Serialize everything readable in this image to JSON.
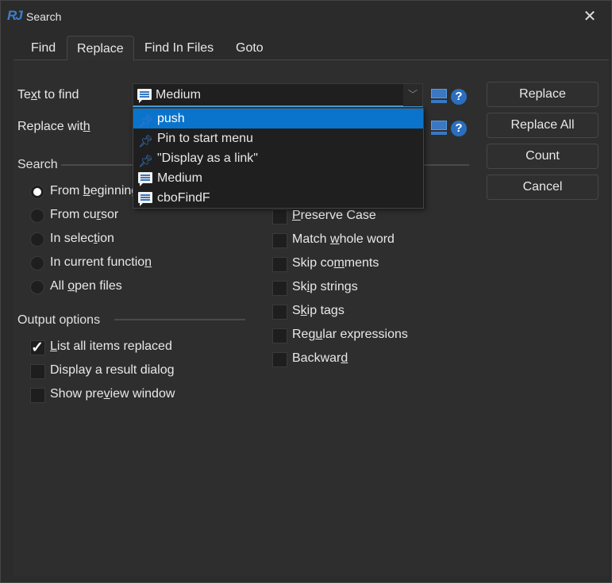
{
  "window": {
    "title": "Search",
    "logo": "RJ",
    "close_icon": "close-icon"
  },
  "tabs": [
    {
      "label": "Find"
    },
    {
      "label": "Replace",
      "active": true
    },
    {
      "label": "Find In Files"
    },
    {
      "label": "Goto"
    }
  ],
  "fields": {
    "find": {
      "pre": "Te",
      "key": "x",
      "post": "t to find",
      "value": "Medium"
    },
    "replace": {
      "pre": "Replace wit",
      "key": "h",
      "post": ""
    }
  },
  "dropdown": {
    "items": [
      {
        "label": "push",
        "icon": "pin-icon",
        "selected": true
      },
      {
        "label": "Pin to start menu",
        "icon": "pin-icon"
      },
      {
        "label": "\"Display as a link\"",
        "icon": "pin-icon"
      },
      {
        "label": "Medium",
        "icon": "message-icon"
      },
      {
        "label": "cboFindF",
        "icon": "message-icon"
      }
    ]
  },
  "buttons": {
    "replace": "Replace",
    "replace_all": "Replace All",
    "count": "Count",
    "cancel": "Cancel"
  },
  "search": {
    "title": "Search",
    "options": [
      {
        "pre": "From ",
        "key": "b",
        "post": "eginning",
        "checked": true
      },
      {
        "pre": "From cu",
        "key": "r",
        "post": "sor",
        "checked": false
      },
      {
        "pre": "In selec",
        "key": "t",
        "post": "ion",
        "checked": false
      },
      {
        "pre": "In current functio",
        "key": "n",
        "post": "",
        "checked": false
      },
      {
        "pre": "All ",
        "key": "o",
        "post": "pen files",
        "checked": false
      }
    ]
  },
  "output": {
    "title": "Output options",
    "options": [
      {
        "pre": "",
        "key": "L",
        "post": "ist all items replaced",
        "checked": true
      },
      {
        "pre": "Display a result dialo",
        "key": "g",
        "post": "",
        "checked": false
      },
      {
        "pre": "Show pre",
        "key": "v",
        "post": "iew window",
        "checked": false
      }
    ]
  },
  "match": {
    "options": [
      {
        "pre": "",
        "key": "P",
        "post": "reserve Case",
        "checked": false
      },
      {
        "pre": "Match ",
        "key": "w",
        "post": "hole word",
        "checked": false
      },
      {
        "pre": "Skip co",
        "key": "m",
        "post": "ments",
        "checked": false
      },
      {
        "pre": "Sk",
        "key": "i",
        "post": "p strings",
        "checked": false
      },
      {
        "pre": "S",
        "key": "k",
        "post": "ip tags",
        "checked": false
      },
      {
        "pre": "Reg",
        "key": "u",
        "post": "lar expressions",
        "checked": false
      },
      {
        "pre": "Backwar",
        "key": "d",
        "post": "",
        "checked": false
      }
    ]
  },
  "colors": {
    "accent": "#0a74cd",
    "background": "#2b2b2b",
    "icon_blue": "#3a78c4"
  }
}
